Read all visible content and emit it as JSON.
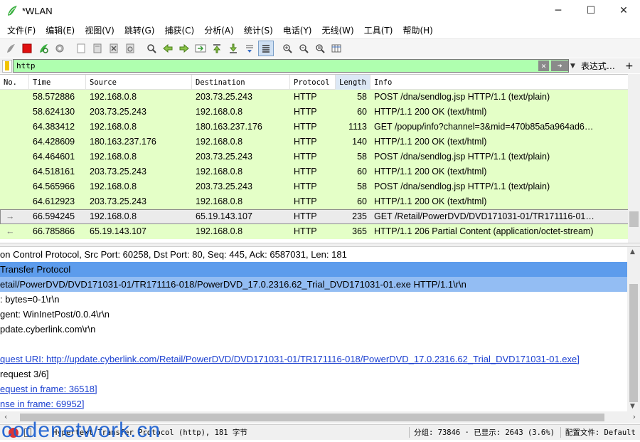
{
  "window": {
    "title": "*WLAN",
    "minimize": "─",
    "maximize": "☐",
    "close": "✕"
  },
  "menu": [
    "文件(F)",
    "编辑(E)",
    "视图(V)",
    "跳转(G)",
    "捕获(C)",
    "分析(A)",
    "统计(S)",
    "电话(Y)",
    "无线(W)",
    "工具(T)",
    "帮助(H)"
  ],
  "filter": {
    "value": "http",
    "expression_label": "表达式…",
    "add_label": "+"
  },
  "columns": [
    "No.",
    "Time",
    "Source",
    "Destination",
    "Protocol",
    "Length",
    "Info"
  ],
  "packets": [
    {
      "time": "58.572886",
      "src": "192.168.0.8",
      "dst": "203.73.25.243",
      "proto": "HTTP",
      "len": "58",
      "info": "POST /dna/sendlog.jsp HTTP/1.1  (text/plain)"
    },
    {
      "time": "58.624130",
      "src": "203.73.25.243",
      "dst": "192.168.0.8",
      "proto": "HTTP",
      "len": "60",
      "info": "HTTP/1.1 200 OK  (text/html)"
    },
    {
      "time": "64.383412",
      "src": "192.168.0.8",
      "dst": "180.163.237.176",
      "proto": "HTTP",
      "len": "1113",
      "info": "GET /popup/info?channel=3&mid=470b85a5a964ad6…"
    },
    {
      "time": "64.428609",
      "src": "180.163.237.176",
      "dst": "192.168.0.8",
      "proto": "HTTP",
      "len": "140",
      "info": "HTTP/1.1 200 OK  (text/html)"
    },
    {
      "time": "64.464601",
      "src": "192.168.0.8",
      "dst": "203.73.25.243",
      "proto": "HTTP",
      "len": "58",
      "info": "POST /dna/sendlog.jsp HTTP/1.1  (text/plain)"
    },
    {
      "time": "64.518161",
      "src": "203.73.25.243",
      "dst": "192.168.0.8",
      "proto": "HTTP",
      "len": "60",
      "info": "HTTP/1.1 200 OK  (text/html)"
    },
    {
      "time": "64.565966",
      "src": "192.168.0.8",
      "dst": "203.73.25.243",
      "proto": "HTTP",
      "len": "58",
      "info": "POST /dna/sendlog.jsp HTTP/1.1  (text/plain)"
    },
    {
      "time": "64.612923",
      "src": "203.73.25.243",
      "dst": "192.168.0.8",
      "proto": "HTTP",
      "len": "60",
      "info": "HTTP/1.1 200 OK  (text/html)"
    },
    {
      "time": "66.594245",
      "src": "192.168.0.8",
      "dst": "65.19.143.107",
      "proto": "HTTP",
      "len": "235",
      "info": "GET /Retail/PowerDVD/DVD171031-01/TR171116-01…"
    },
    {
      "time": "66.785866",
      "src": "65.19.143.107",
      "dst": "192.168.0.8",
      "proto": "HTTP",
      "len": "365",
      "info": "HTTP/1.1 206 Partial Content  (application/octet-stream)"
    }
  ],
  "details": [
    "on Control Protocol, Src Port: 60258, Dst Port: 80, Seq: 445, Ack: 6587031, Len: 181",
    " Transfer Protocol",
    "etail/PowerDVD/DVD171031-01/TR171116-018/PowerDVD_17.0.2316.62_Trial_DVD171031-01.exe HTTP/1.1\\r\\n",
    ": bytes=0-1\\r\\n",
    "gent: WinInetPost/0.0.4\\r\\n",
    "pdate.cyberlink.com\\r\\n",
    "",
    "quest URI: http://update.cyberlink.com/Retail/PowerDVD/DVD171031-01/TR171116-018/PowerDVD_17.0.2316.62_Trial_DVD171031-01.exe]",
    "request 3/6]",
    "equest in frame: 36518]",
    "nse in frame: 69952]"
  ],
  "status": {
    "field": "Hypertext Transfer Protocol (http), 181 字节",
    "packets": "分组: 73846 · 已显示: 2643 (3.6%)",
    "profile": "配置文件: Default"
  },
  "watermark": "codenetwork.cn",
  "colors": {
    "filter_bg": "#afffaf",
    "row_bg": "#e4ffc7",
    "selected_detail": "#5d9cec"
  }
}
